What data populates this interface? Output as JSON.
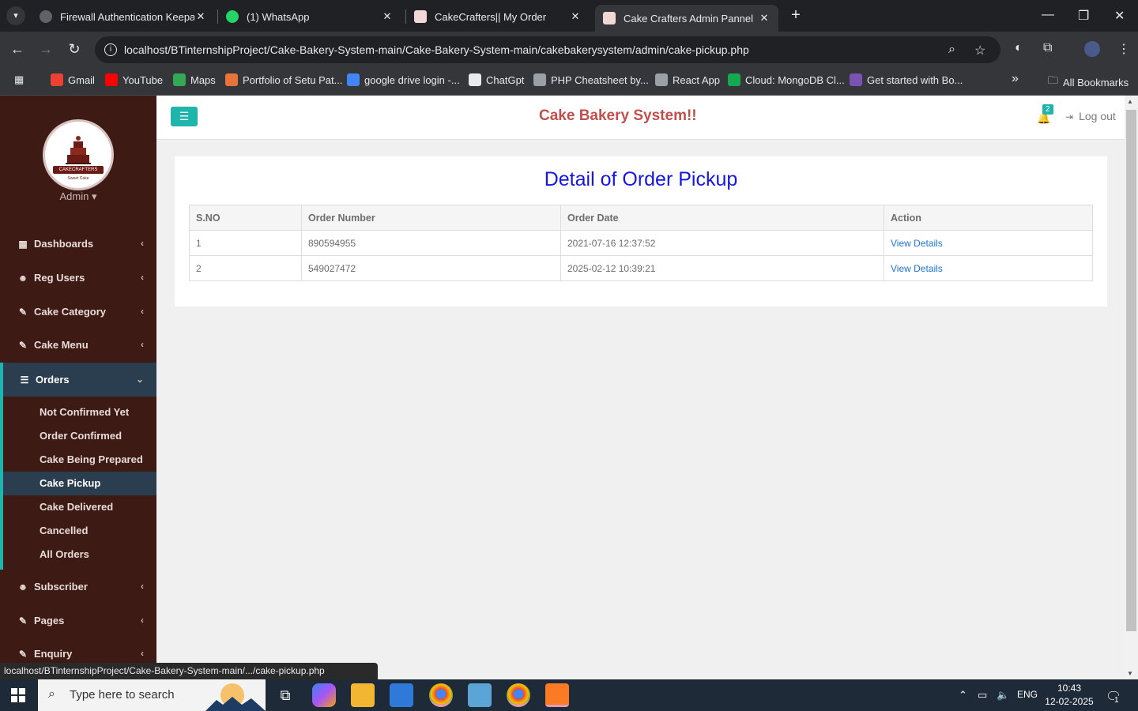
{
  "browser": {
    "tabs": [
      {
        "title": "Firewall Authentication Keepaliv",
        "close": "✕"
      },
      {
        "title": "(1) WhatsApp",
        "close": "✕"
      },
      {
        "title": "CakeCrafters|| My Order",
        "close": "✕"
      },
      {
        "title": "Cake Crafters Admin Pannel",
        "close": "✕"
      }
    ],
    "new_tab": "+",
    "url_host": "localhost",
    "url_path": "/BTinternshipProject/Cake-Bakery-System-main/Cake-Bakery-System-main/cakebakerysystem/admin/cake-pickup.php",
    "bookmarks": [
      {
        "label": "Gmail",
        "color": "#ea4335"
      },
      {
        "label": "YouTube",
        "color": "#ff0000"
      },
      {
        "label": "Maps",
        "color": "#34a853"
      },
      {
        "label": "Portfolio of Setu Pat...",
        "color": "#e8743b"
      },
      {
        "label": "google drive login -...",
        "color": "#4285f4"
      },
      {
        "label": "ChatGpt",
        "color": "#e8eaed"
      },
      {
        "label": "PHP Cheatsheet by...",
        "color": "#9aa0a6"
      },
      {
        "label": "React App",
        "color": "#9aa0a6"
      },
      {
        "label": "Cloud: MongoDB Cl...",
        "color": "#13aa52"
      },
      {
        "label": "Get started with Bo...",
        "color": "#7952b3"
      }
    ],
    "bookmarks_overflow": "»",
    "all_bookmarks": "All Bookmarks",
    "status_url": "localhost/BTinternshipProject/Cake-Bakery-System-main/.../cake-pickup.php"
  },
  "sidebar": {
    "logo_brand": "CAKECRAFTERS",
    "logo_sub": "Sweet Cake",
    "admin_label": "Admin ▾",
    "items": [
      {
        "label": "Dashboards",
        "icon": "dashboard-icon",
        "glyph": "▦"
      },
      {
        "label": "Reg Users",
        "icon": "users-icon",
        "glyph": "👥"
      },
      {
        "label": "Cake Category",
        "icon": "edit-icon",
        "glyph": "✎"
      },
      {
        "label": "Cake Menu",
        "icon": "edit-icon",
        "glyph": "✎"
      },
      {
        "label": "Orders",
        "icon": "list-icon",
        "glyph": "☰"
      },
      {
        "label": "Subscriber",
        "icon": "users-icon",
        "glyph": "👥"
      },
      {
        "label": "Pages",
        "icon": "edit-icon",
        "glyph": "✎"
      },
      {
        "label": "Enquiry",
        "icon": "edit-icon",
        "glyph": "✎"
      }
    ],
    "order_submenu": [
      "Not Confirmed Yet",
      "Order Confirmed",
      "Cake Being Prepared",
      "Cake Pickup",
      "Cake Delivered",
      "Cancelled",
      "All Orders"
    ]
  },
  "header": {
    "title": "Cake Bakery System!!",
    "notification_count": "2",
    "logout_label": "Log out"
  },
  "main": {
    "panel_title": "Detail of Order Pickup",
    "columns": [
      "S.NO",
      "Order Number",
      "Order Date",
      "Action"
    ],
    "rows": [
      {
        "sno": "1",
        "order_number": "890594955",
        "order_date": "2021-07-16 12:37:52",
        "action": "View Details"
      },
      {
        "sno": "2",
        "order_number": "549027472",
        "order_date": "2025-02-12 10:39:21",
        "action": "View Details"
      }
    ]
  },
  "taskbar": {
    "search_placeholder": "Type here to search",
    "lang": "ENG",
    "time": "10:43",
    "date": "12-02-2025",
    "notif_count": "1"
  },
  "colors": {
    "sidebar_bg": "#3e1a14",
    "accent": "#1fb5ac",
    "title_red": "#c0504d",
    "panel_title_blue": "#1515e6",
    "link_blue": "#1e74d6"
  }
}
